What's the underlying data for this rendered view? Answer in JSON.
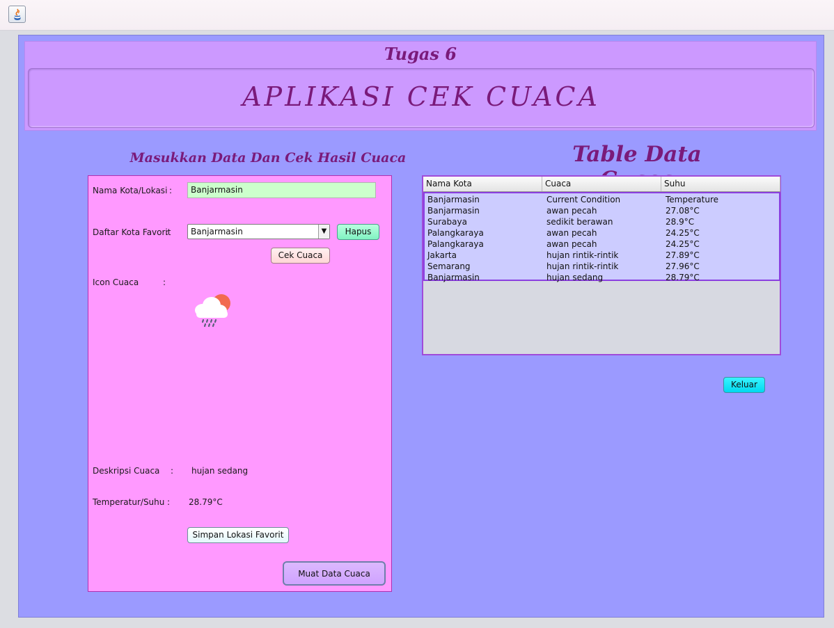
{
  "header": {
    "subtitle": "Tugas 6",
    "title": "APLIKASI CEK CUACA"
  },
  "left_section": {
    "heading": "Masukkan Data Dan Cek Hasil Cuaca",
    "city_label": "Nama Kota/Lokasi",
    "city_value": "Banjarmasin",
    "favorite_label": "Daftar Kota Favorit",
    "favorite_selected": "Banjarmasin",
    "delete_button": "Hapus",
    "check_button": "Cek Cuaca",
    "icon_label": "Icon Cuaca",
    "weather_icon": "cloud-sun-rain-icon",
    "description_label": "Deskripsi Cuaca",
    "description_value": "hujan sedang",
    "temperature_label": "Temperatur/Suhu",
    "temperature_value": "28.79°C",
    "save_button": "Simpan Lokasi Favorit",
    "load_button": "Muat Data Cuaca",
    "colon": ":"
  },
  "right_section": {
    "heading": "Table Data Cuaca",
    "columns": [
      "Nama Kota",
      "Cuaca",
      "Suhu"
    ],
    "rows": [
      [
        "Banjarmasin",
        "Current Condition",
        "Temperature"
      ],
      [
        "Banjarmasin",
        "awan pecah",
        "27.08°C"
      ],
      [
        "Surabaya",
        "sedikit berawan",
        "28.9°C"
      ],
      [
        "Palangkaraya",
        "awan pecah",
        "24.25°C"
      ],
      [
        "Palangkaraya",
        "awan pecah",
        "24.25°C"
      ],
      [
        "Jakarta",
        "hujan rintik-rintik",
        "27.89°C"
      ],
      [
        "Semarang",
        "hujan rintik-rintik",
        "27.96°C"
      ],
      [
        "Banjarmasin",
        "hujan sedang",
        "28.79°C"
      ]
    ],
    "exit_button": "Keluar"
  },
  "colors": {
    "background": "#9b9aff",
    "header": "#cc99ff",
    "form_panel": "#ff99ff",
    "title_text": "#7a1a7a",
    "table_rows": "#ccccff",
    "city_input": "#ccffcc"
  }
}
